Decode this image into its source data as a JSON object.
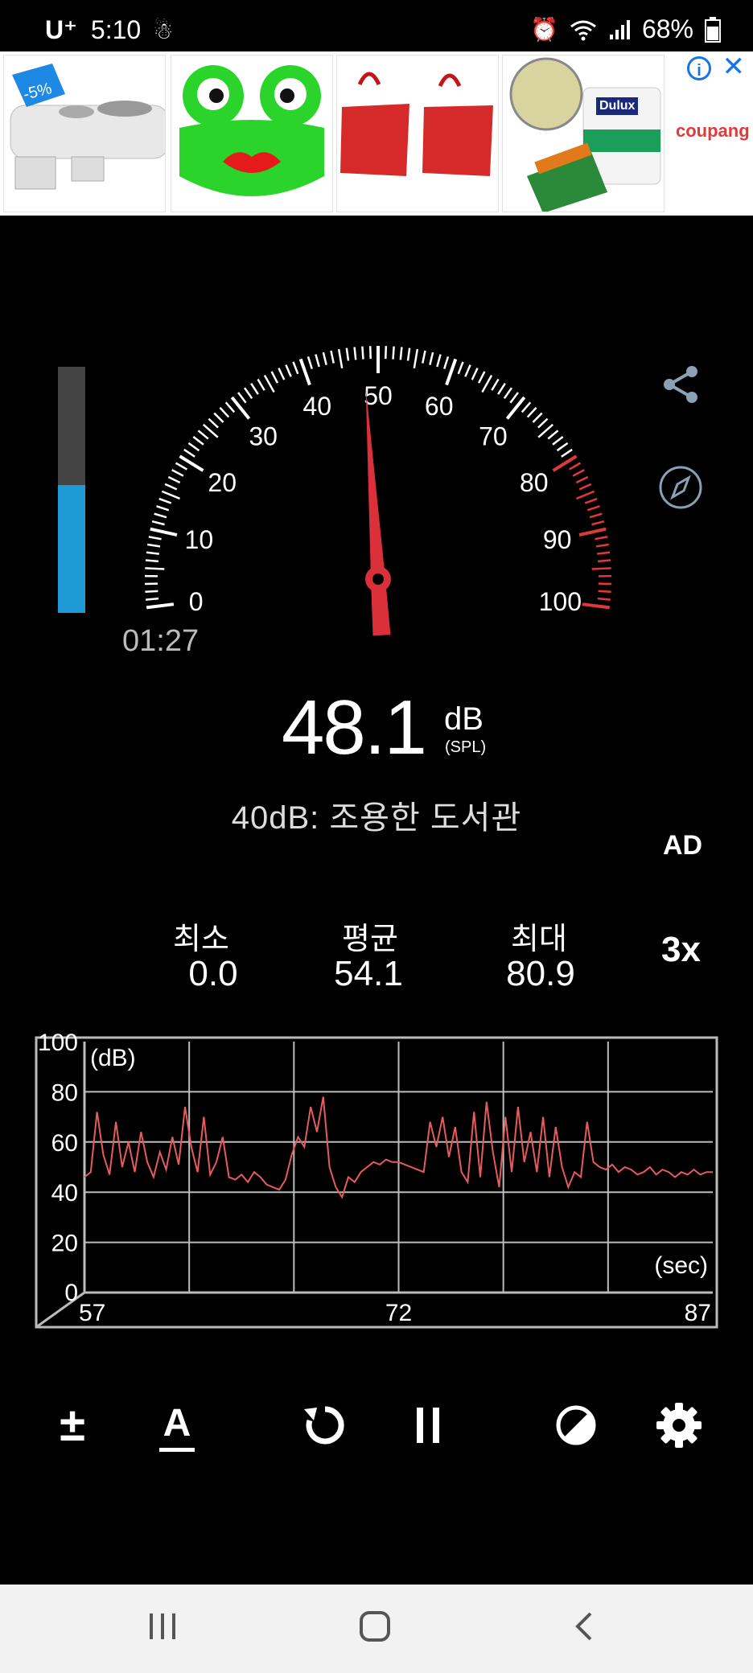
{
  "status_bar": {
    "carrier": "U⁺",
    "time": "5:10",
    "battery": "68%"
  },
  "ad": {
    "coupang": "coupang",
    "badge": "-5%",
    "info_icon": "info-icon",
    "close_icon": "close-icon",
    "paint_brand": "Dulux"
  },
  "meter": {
    "scale_labels": [
      "0",
      "10",
      "20",
      "30",
      "40",
      "50",
      "60",
      "70",
      "80",
      "90",
      "100"
    ],
    "needle_value": 48.1,
    "level_fraction": 0.52,
    "timer": "01:27",
    "value": "48.1",
    "unit": "dB",
    "unit_sub": "(SPL)",
    "reference": "40dB: 조용한 도서관",
    "ad_toggle": "AD"
  },
  "stats": {
    "min_label": "최소",
    "min_value": "0.0",
    "avg_label": "평균",
    "avg_value": "54.1",
    "max_label": "최대",
    "max_value": "80.9",
    "scale": "3x"
  },
  "chart_data": {
    "type": "line",
    "ylabel": "(dB)",
    "xlabel": "(sec)",
    "ylim": [
      0,
      100
    ],
    "xlim": [
      57,
      87
    ],
    "y_ticks": [
      "100",
      "80",
      "60",
      "40",
      "20",
      "0"
    ],
    "x_ticks": [
      "57",
      "72",
      "87"
    ],
    "grid": true,
    "series": [
      {
        "x": [
          57.0,
          57.3,
          57.6,
          57.9,
          58.2,
          58.5,
          58.8,
          59.1,
          59.4,
          59.7,
          60.0,
          60.3,
          60.6,
          60.9,
          61.2,
          61.5,
          61.8,
          62.1,
          62.4,
          62.7,
          63.0,
          63.3,
          63.6,
          63.9,
          64.2,
          64.5,
          64.8,
          65.1,
          65.4,
          65.7,
          66.0,
          66.3,
          66.6,
          66.9,
          67.2,
          67.5,
          67.8,
          68.1,
          68.4,
          68.7,
          69.0,
          69.3,
          69.6,
          69.9,
          70.2,
          70.5,
          70.8,
          71.1,
          71.4,
          71.7,
          72.0,
          72.3,
          72.6,
          72.9,
          73.2,
          73.5,
          73.8,
          74.1,
          74.4,
          74.7,
          75.0,
          75.3,
          75.6,
          75.9,
          76.2,
          76.5,
          76.8,
          77.1,
          77.4,
          77.7,
          78.0,
          78.3,
          78.6,
          78.9,
          79.2,
          79.5,
          79.8,
          80.1,
          80.4,
          80.7,
          81.0,
          81.3,
          81.6,
          81.9,
          82.2,
          82.5,
          82.8,
          83.1,
          83.4,
          83.7,
          84.0,
          84.3,
          84.6,
          84.9,
          85.2,
          85.5,
          85.8,
          86.1,
          86.4,
          86.7,
          87.0
        ],
        "values": [
          46,
          48,
          72,
          55,
          47,
          68,
          50,
          60,
          48,
          64,
          52,
          46,
          56,
          49,
          62,
          51,
          74,
          58,
          48,
          70,
          47,
          52,
          62,
          46,
          45,
          47,
          44,
          48,
          46,
          43,
          42,
          41,
          45,
          55,
          62,
          58,
          74,
          64,
          78,
          50,
          42,
          38,
          46,
          44,
          48,
          50,
          52,
          51,
          53,
          52,
          52,
          51,
          50,
          49,
          48,
          68,
          58,
          70,
          54,
          66,
          48,
          44,
          72,
          46,
          76,
          56,
          42,
          70,
          48,
          74,
          52,
          64,
          48,
          70,
          46,
          66,
          50,
          42,
          48,
          46,
          68,
          52,
          50,
          49,
          51,
          48,
          50,
          49,
          47,
          48,
          50,
          47,
          49,
          48,
          46,
          48,
          47,
          49,
          47,
          48,
          48
        ]
      }
    ]
  },
  "toolbar": {
    "calibrate": "±",
    "weighting": "A",
    "reset_icon": "reset-icon",
    "pause_icon": "pause-icon",
    "theme_icon": "theme-icon",
    "settings_icon": "gear-icon"
  },
  "side": {
    "share_icon": "share-icon",
    "compass_icon": "compass-icon"
  },
  "nav": {
    "recents_icon": "recents-icon",
    "home_icon": "home-icon",
    "back_icon": "back-icon"
  }
}
